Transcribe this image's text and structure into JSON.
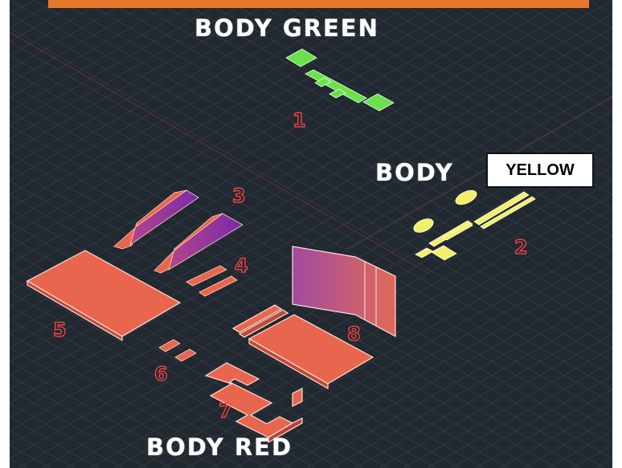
{
  "labels": {
    "body_green": "BODY GREEN",
    "body_yellow_prefix": "BODY",
    "body_yellow_box": "YELLOW",
    "body_red": "BODY RED"
  },
  "part_numbers": {
    "p1": "1",
    "p2": "2",
    "p3": "3",
    "p4": "4",
    "p5": "5",
    "p6": "6",
    "p7": "7",
    "p8": "8"
  },
  "colors": {
    "background": "#212830",
    "grid": "#2f3742",
    "green": "#6be04a",
    "yellow": "#f2ef6a",
    "red": "#e8664d",
    "purple": "#7a2aa8",
    "orange_bar": "#e8782c",
    "number_outline": "#ff4444"
  }
}
